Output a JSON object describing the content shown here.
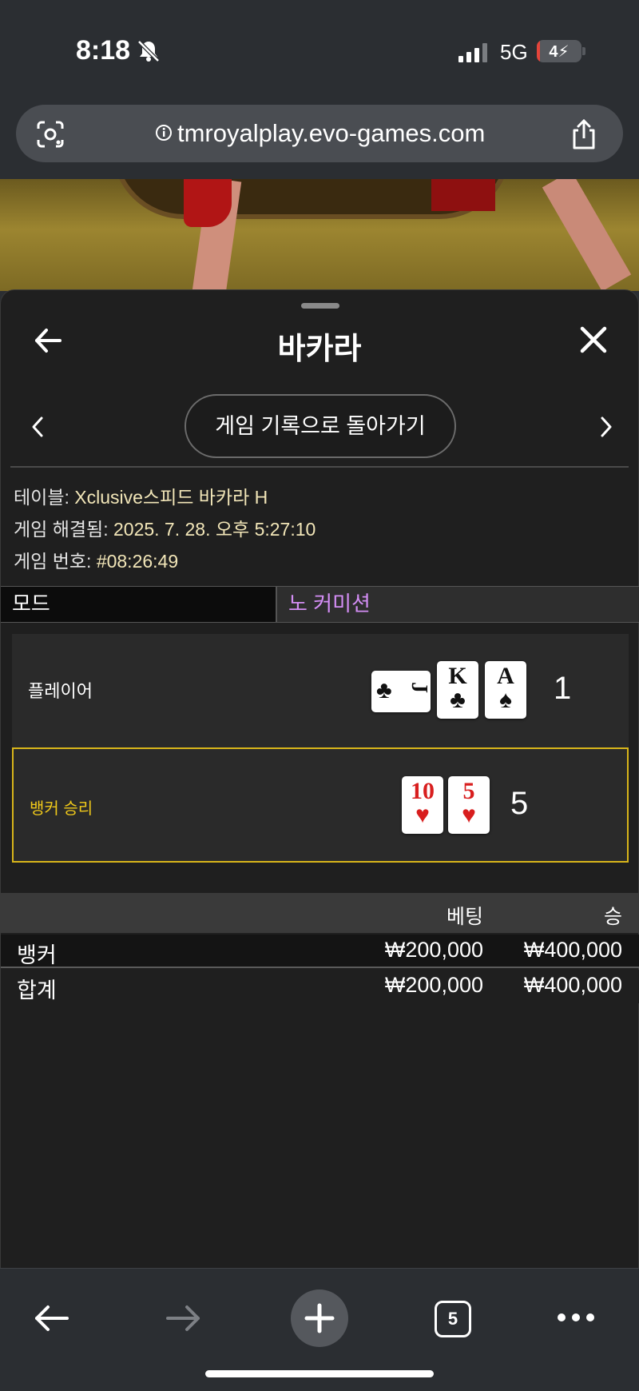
{
  "status_bar": {
    "time": "8:18",
    "network": "5G",
    "battery": "4",
    "battery_level_percent": 4
  },
  "browser": {
    "url": "tmroyalplay.evo-games.com",
    "tab_count": "5"
  },
  "sheet": {
    "title": "바카라",
    "history_button": "게임 기록으로 돌아가기",
    "info": {
      "table_label": "테이블: ",
      "table_value": "Xclusive스피드 바카라 H",
      "resolved_label": "게임 해결됨: ",
      "resolved_value": "2025. 7. 28. 오후 5:27:10",
      "game_no_label": "게임 번호: ",
      "game_no_value": "#08:26:49"
    },
    "mode": {
      "label": "모드",
      "value": "노 커미션"
    },
    "result": {
      "player": {
        "label": "플레이어",
        "score": "1",
        "cards": [
          {
            "rank": "J",
            "suit": "♣",
            "color": "black",
            "sideways": true
          },
          {
            "rank": "K",
            "suit": "♣",
            "color": "black",
            "sideways": false
          },
          {
            "rank": "A",
            "suit": "♠",
            "color": "black",
            "sideways": false
          }
        ]
      },
      "banker": {
        "label": "뱅커 승리",
        "score": "5",
        "cards": [
          {
            "rank": "10",
            "suit": "♥",
            "color": "red",
            "sideways": false
          },
          {
            "rank": "5",
            "suit": "♥",
            "color": "red",
            "sideways": false
          }
        ]
      }
    },
    "bets": {
      "headers": {
        "bet": "베팅",
        "win": "승"
      },
      "rows": [
        {
          "name": "뱅커",
          "bet": "₩200,000",
          "win": "₩400,000"
        },
        {
          "name": "합계",
          "bet": "₩200,000",
          "win": "₩400,000"
        }
      ]
    }
  },
  "colors": {
    "accent_win": "#f0c91a",
    "mode_value": "#d48ef5",
    "info_value": "#f2e6b8",
    "card_red": "#d81e1e"
  }
}
